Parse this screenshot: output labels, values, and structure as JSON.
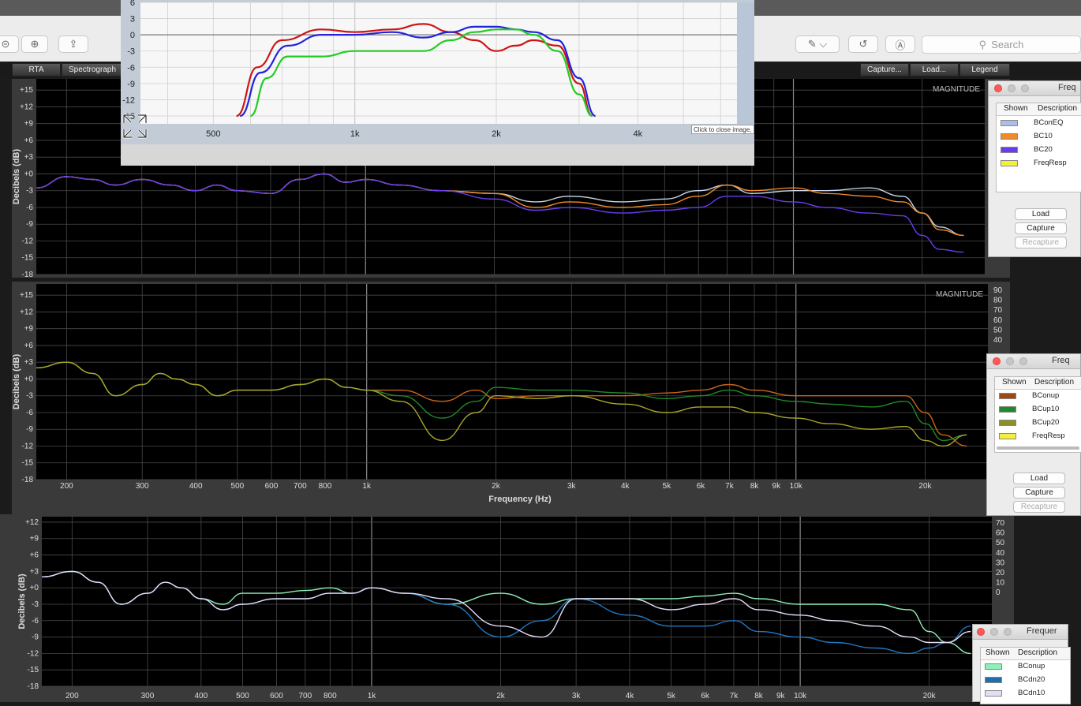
{
  "toolbar": {
    "search_placeholder": "Search",
    "buttons": [
      "zoom-out",
      "zoom-in",
      "share",
      "markup",
      "rotate",
      "annotate"
    ]
  },
  "rew": {
    "tabs_left": [
      "RTA",
      "Spectrograph"
    ],
    "tabs_right": [
      "Capture...",
      "Load...",
      "Legend"
    ]
  },
  "overlay": {
    "tooltip": "Click to close image, c",
    "colors": {
      "red": "#cc1515",
      "blue": "#2222dd",
      "green": "#22cc22"
    }
  },
  "legend1": {
    "title": "Freq",
    "headers": [
      "Shown",
      "Description"
    ],
    "rows": [
      {
        "name": "BConEQ",
        "color": "#a9c0e4"
      },
      {
        "name": "BC10",
        "color": "#f08a2a"
      },
      {
        "name": "BC20",
        "color": "#6a3cf0"
      },
      {
        "name": "FreqResp",
        "color": "#f4f03a"
      }
    ],
    "buttons": [
      "Load",
      "Capture",
      "Recapture"
    ]
  },
  "legend2": {
    "title": "Freq",
    "headers": [
      "Shown",
      "Description"
    ],
    "rows": [
      {
        "name": "BConup",
        "color": "#9b4a14"
      },
      {
        "name": "BCup10",
        "color": "#1f8a2a"
      },
      {
        "name": "BCup20",
        "color": "#8f8f2a"
      },
      {
        "name": "FreqResp",
        "color": "#f4f03a"
      }
    ],
    "buttons": [
      "Load",
      "Capture",
      "Recapture"
    ]
  },
  "legend3": {
    "title": "Frequer",
    "headers": [
      "Shown",
      "Description"
    ],
    "rows": [
      {
        "name": "BConup",
        "color": "#8ef0b8"
      },
      {
        "name": "BCdn20",
        "color": "#1f6fa8"
      },
      {
        "name": "BCdn10",
        "color": "#e6dcf4"
      }
    ]
  },
  "chart_data": [
    {
      "type": "line",
      "id": "overlay-zoom",
      "x_ticks": [
        "500",
        "1k",
        "2k",
        "4k"
      ],
      "y_ticks": [
        "6",
        "3",
        "0",
        "-3",
        "-6",
        "-9",
        "-12",
        "-15"
      ],
      "ylim": [
        -15,
        6
      ],
      "x_scale": "log",
      "xlim": [
        350,
        6500
      ],
      "series": [
        {
          "color": "red",
          "x": [
            560,
            620,
            700,
            850,
            1000,
            1200,
            1400,
            1600,
            1800,
            2000,
            2200,
            2400,
            2700,
            3000,
            3200
          ],
          "y": [
            -15,
            -6,
            -1,
            1,
            0.5,
            1,
            2,
            0.5,
            -1,
            -3,
            -2,
            -1,
            -2,
            -9,
            -15
          ]
        },
        {
          "color": "blue",
          "x": [
            570,
            630,
            720,
            850,
            1000,
            1200,
            1400,
            1600,
            1800,
            2000,
            2200,
            2400,
            2700,
            3000,
            3250
          ],
          "y": [
            -15,
            -7,
            -2,
            0,
            0,
            0.5,
            -0.5,
            0.5,
            1.5,
            1.5,
            1,
            0.5,
            -1,
            -8,
            -15
          ]
        },
        {
          "color": "green",
          "x": [
            600,
            650,
            720,
            850,
            1000,
            1200,
            1400,
            1600,
            1800,
            2000,
            2200,
            2400,
            2700,
            3000,
            3200
          ],
          "y": [
            -15,
            -8,
            -4,
            -4,
            -3,
            -3,
            -3,
            -1,
            0.5,
            1,
            1,
            0,
            -3,
            -11,
            -15
          ]
        }
      ]
    },
    {
      "type": "line",
      "id": "panel-1",
      "title": "MAGNITUDE",
      "ylabel": "Decibels (dB)",
      "y_ticks": [
        "+15",
        "+12",
        "+9",
        "+6",
        "+3",
        "+0",
        "-3",
        "-6",
        "-9",
        "-12",
        "-15",
        "-18"
      ],
      "ylim": [
        -18,
        17
      ],
      "x_scale": "log",
      "xlim": [
        170,
        28000
      ],
      "series": [
        {
          "name": "BConEQ",
          "x": [
            170,
            200,
            230,
            260,
            300,
            350,
            400,
            450,
            500,
            600,
            700,
            800,
            900,
            1000,
            1200,
            1500,
            2000,
            2500,
            3000,
            4000,
            5000,
            6000,
            7000,
            8000,
            10000,
            12000,
            15000,
            18000,
            20000,
            22000,
            25000
          ],
          "y": [
            -2.5,
            -0.5,
            -1,
            -2,
            -1,
            -2,
            -3,
            -2,
            -3,
            -3.5,
            -1,
            0,
            -1.5,
            -1,
            -2,
            -3,
            -3.5,
            -5,
            -4,
            -5,
            -4.5,
            -3,
            -2,
            -3.5,
            -3,
            -3,
            -2.5,
            -4,
            -7,
            -9.5,
            -11
          ]
        },
        {
          "name": "BC10",
          "x": [
            170,
            200,
            230,
            260,
            300,
            350,
            400,
            450,
            500,
            600,
            700,
            800,
            900,
            1000,
            1200,
            1500,
            2000,
            2500,
            3000,
            4000,
            5000,
            6000,
            7000,
            8000,
            10000,
            12000,
            15000,
            18000,
            20000,
            22000,
            25000
          ],
          "y": [
            -2.5,
            -0.5,
            -1,
            -2,
            -1,
            -2,
            -3,
            -2,
            -3,
            -3.5,
            -1,
            0,
            -1.5,
            -1,
            -2,
            -3,
            -3.5,
            -6,
            -5,
            -6,
            -5.5,
            -4,
            -2,
            -3,
            -2.5,
            -3.5,
            -4,
            -5,
            -7,
            -10,
            -11
          ]
        },
        {
          "name": "BC20",
          "x": [
            170,
            200,
            230,
            260,
            300,
            350,
            400,
            450,
            500,
            600,
            700,
            800,
            900,
            1000,
            1200,
            1500,
            2000,
            2500,
            3000,
            4000,
            5000,
            6000,
            7000,
            8000,
            10000,
            12000,
            15000,
            18000,
            20000,
            22000,
            25000
          ],
          "y": [
            -2.5,
            -0.5,
            -1,
            -2,
            -1,
            -2,
            -3,
            -2,
            -3,
            -3.5,
            -1,
            0,
            -1.5,
            -1,
            -2,
            -3,
            -4.5,
            -6.5,
            -6,
            -7,
            -6.5,
            -6,
            -4,
            -4,
            -5,
            -6,
            -7,
            -7.5,
            -11,
            -13.5,
            -14
          ]
        }
      ]
    },
    {
      "type": "line",
      "id": "panel-2",
      "title": "MAGNITUDE",
      "ylabel": "Decibels (dB)",
      "xlabel": "Frequency (Hz)",
      "x_ticks": [
        "200",
        "300",
        "400",
        "500",
        "600",
        "700",
        "800",
        "1k",
        "2k",
        "3k",
        "4k",
        "5k",
        "6k",
        "7k",
        "8k",
        "9k",
        "10k",
        "20k"
      ],
      "y_ticks": [
        "+15",
        "+12",
        "+9",
        "+6",
        "+3",
        "+0",
        "-3",
        "-6",
        "-9",
        "-12",
        "-15",
        "-18"
      ],
      "y2_ticks": [
        "90",
        "80",
        "70",
        "60",
        "50",
        "40"
      ],
      "ylim": [
        -18,
        17
      ],
      "x_scale": "log",
      "xlim": [
        170,
        28000
      ],
      "series": [
        {
          "name": "BConup",
          "x": [
            170,
            200,
            230,
            260,
            300,
            330,
            360,
            400,
            450,
            500,
            600,
            700,
            800,
            900,
            1000,
            1200,
            1500,
            1800,
            2000,
            2500,
            3000,
            4000,
            5000,
            6000,
            7000,
            8000,
            10000,
            12000,
            15000,
            18000,
            20000,
            22000,
            25000
          ],
          "y": [
            2,
            3,
            1,
            -3,
            -1,
            1,
            0,
            -1,
            -3,
            -2,
            -2,
            -1,
            0,
            -1.5,
            -2,
            -2,
            -4,
            -2,
            -3.5,
            -3,
            -3,
            -3,
            -2.5,
            -2,
            -1,
            -2,
            -3,
            -3,
            -3,
            -3,
            -6,
            -10,
            -12
          ]
        },
        {
          "name": "BCup10",
          "x": [
            170,
            200,
            230,
            260,
            300,
            330,
            360,
            400,
            450,
            500,
            600,
            700,
            800,
            900,
            1000,
            1200,
            1500,
            1800,
            2000,
            2500,
            3000,
            4000,
            5000,
            6000,
            7000,
            8000,
            10000,
            12000,
            15000,
            18000,
            20000,
            22000,
            25000
          ],
          "y": [
            2,
            3,
            1,
            -3,
            -1,
            1,
            0,
            -1,
            -3,
            -2,
            -2,
            -1,
            0,
            -1.5,
            -2,
            -3,
            -7,
            -4,
            -1.5,
            -2,
            -2,
            -2.5,
            -3.5,
            -3,
            -2,
            -3,
            -4,
            -4.5,
            -5,
            -4,
            -8,
            -11,
            -10
          ]
        },
        {
          "name": "BCup20",
          "x": [
            170,
            200,
            230,
            260,
            300,
            330,
            360,
            400,
            450,
            500,
            600,
            700,
            800,
            900,
            1000,
            1200,
            1500,
            1800,
            2000,
            2500,
            3000,
            4000,
            5000,
            6000,
            7000,
            8000,
            10000,
            12000,
            15000,
            18000,
            20000,
            22000,
            25000
          ],
          "y": [
            2,
            3,
            1,
            -3,
            -1,
            1,
            0,
            -1,
            -3,
            -2,
            -2,
            -1,
            0,
            -1.5,
            -2,
            -4,
            -11,
            -6,
            -3,
            -3.5,
            -3,
            -4.5,
            -6,
            -5,
            -5,
            -6,
            -7,
            -8,
            -9,
            -8.5,
            -11,
            -12,
            -10
          ]
        }
      ]
    },
    {
      "type": "line",
      "id": "panel-3",
      "ylabel": "Decibels (dB)",
      "x_ticks": [
        "200",
        "300",
        "400",
        "500",
        "600",
        "700",
        "800",
        "1k",
        "2k",
        "3k",
        "4k",
        "5k",
        "6k",
        "7k",
        "8k",
        "9k",
        "10k",
        "20k"
      ],
      "y_ticks": [
        "+12",
        "+9",
        "+6",
        "+3",
        "+0",
        "-3",
        "-6",
        "-9",
        "-12",
        "-15",
        "-18"
      ],
      "y2_ticks": [
        "70",
        "60",
        "50",
        "40",
        "30",
        "20",
        "10",
        "0"
      ],
      "ylim": [
        -18,
        13
      ],
      "x_scale": "log",
      "xlim": [
        170,
        28000
      ],
      "series": [
        {
          "name": "BConup",
          "x": [
            170,
            200,
            230,
            260,
            300,
            330,
            360,
            400,
            450,
            500,
            600,
            700,
            800,
            900,
            1000,
            1200,
            1500,
            2000,
            2500,
            3000,
            4000,
            5000,
            6000,
            7000,
            8000,
            10000,
            12000,
            15000,
            18000,
            20000,
            22000,
            25000
          ],
          "y": [
            2,
            3,
            1,
            -3,
            -1,
            1,
            0,
            -2,
            -3,
            -1,
            -1,
            -0.5,
            0,
            -1,
            0,
            -1,
            -3,
            -1,
            -3,
            -2,
            -2,
            -2,
            -1.5,
            -1,
            -2,
            -3,
            -3,
            -3,
            -4,
            -8,
            -10,
            -12
          ]
        },
        {
          "name": "BCdn20",
          "x": [
            170,
            200,
            230,
            260,
            300,
            330,
            360,
            400,
            450,
            500,
            600,
            700,
            800,
            900,
            1000,
            1200,
            1500,
            2000,
            2500,
            3000,
            4000,
            5000,
            6000,
            7000,
            8000,
            10000,
            12000,
            15000,
            18000,
            20000,
            22000,
            25000
          ],
          "y": [
            2,
            3,
            1,
            -3,
            -1,
            1,
            0,
            -2,
            -4,
            -3,
            -2,
            -2,
            -1,
            -1,
            0,
            -1,
            -3,
            -9,
            -6,
            -2,
            -5,
            -7,
            -7,
            -6,
            -8,
            -9,
            -10,
            -11,
            -12,
            -11,
            -10,
            -7
          ]
        },
        {
          "name": "BCdn10",
          "x": [
            170,
            200,
            230,
            260,
            300,
            330,
            360,
            400,
            450,
            500,
            600,
            700,
            800,
            900,
            1000,
            1200,
            1500,
            2000,
            2500,
            3000,
            4000,
            5000,
            6000,
            7000,
            8000,
            10000,
            12000,
            15000,
            18000,
            20000,
            22000,
            25000
          ],
          "y": [
            2,
            3,
            1,
            -3,
            -1,
            1,
            0,
            -2,
            -4,
            -3,
            -2,
            -2,
            -1,
            -1,
            0,
            -1,
            -2,
            -7,
            -9,
            -2,
            -2,
            -4,
            -3,
            -2,
            -4,
            -5,
            -6,
            -7,
            -9,
            -10,
            -10,
            -8
          ]
        }
      ]
    }
  ]
}
